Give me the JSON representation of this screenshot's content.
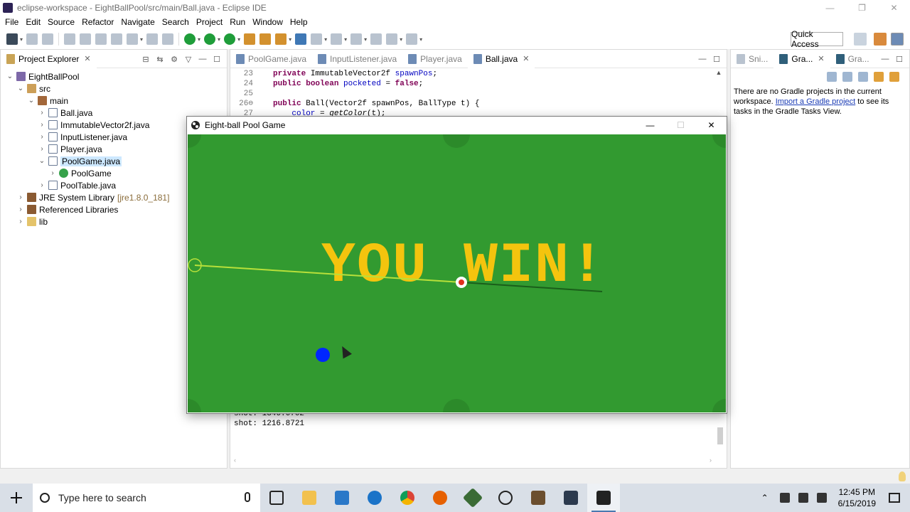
{
  "window": {
    "title": "eclipse-workspace - EightBallPool/src/main/Ball.java - Eclipse IDE",
    "controls": [
      "—",
      "❐",
      "✕"
    ]
  },
  "menu": [
    "File",
    "Edit",
    "Source",
    "Refactor",
    "Navigate",
    "Search",
    "Project",
    "Run",
    "Window",
    "Help"
  ],
  "toolbar": {
    "quick_access": "Quick Access"
  },
  "explorer": {
    "title": "Project Explorer",
    "tree": [
      {
        "label": "EightBallPool",
        "icon": "project-icon",
        "twisty": "⌄",
        "indent": 0
      },
      {
        "label": "src",
        "icon": "source-folder-icon",
        "twisty": "⌄",
        "indent": 1
      },
      {
        "label": "main",
        "icon": "package-icon",
        "twisty": "⌄",
        "indent": 2
      },
      {
        "label": "Ball.java",
        "icon": "java-file-icon",
        "twisty": "›",
        "indent": 3
      },
      {
        "label": "ImmutableVector2f.java",
        "icon": "java-file-icon",
        "twisty": "›",
        "indent": 3
      },
      {
        "label": "InputListener.java",
        "icon": "java-file-icon",
        "twisty": "›",
        "indent": 3
      },
      {
        "label": "Player.java",
        "icon": "java-file-icon",
        "twisty": "›",
        "indent": 3
      },
      {
        "label": "PoolGame.java",
        "icon": "java-file-icon",
        "twisty": "⌄",
        "indent": 3,
        "selected": true
      },
      {
        "label": "PoolGame",
        "icon": "class-icon",
        "twisty": "›",
        "indent": 4
      },
      {
        "label": "PoolTable.java",
        "icon": "java-file-icon",
        "twisty": "›",
        "indent": 3
      },
      {
        "label": "JRE System Library",
        "icon": "library-icon",
        "twisty": "›",
        "indent": 1,
        "suffix": "[jre1.8.0_181]"
      },
      {
        "label": "Referenced Libraries",
        "icon": "library-icon",
        "twisty": "›",
        "indent": 1
      },
      {
        "label": "lib",
        "icon": "folder-icon",
        "twisty": "›",
        "indent": 1
      }
    ]
  },
  "editor": {
    "tabs": [
      {
        "label": "PoolGame.java",
        "active": false
      },
      {
        "label": "InputListener.java",
        "active": false
      },
      {
        "label": "Player.java",
        "active": false
      },
      {
        "label": "Ball.java",
        "active": true
      }
    ],
    "lines": [
      {
        "num": "23",
        "parts": [
          {
            "t": "private ",
            "c": "kw"
          },
          {
            "t": "ImmutableVector2f ",
            "c": ""
          },
          {
            "t": "spawnPos",
            "c": "fld"
          },
          {
            "t": ";",
            "c": ""
          }
        ]
      },
      {
        "num": "24",
        "parts": [
          {
            "t": "public ",
            "c": "kw"
          },
          {
            "t": "boolean ",
            "c": "kw"
          },
          {
            "t": "pocketed",
            "c": "fld"
          },
          {
            "t": " = ",
            "c": ""
          },
          {
            "t": "false",
            "c": "kw"
          },
          {
            "t": ";",
            "c": ""
          }
        ]
      },
      {
        "num": "25",
        "parts": []
      },
      {
        "num": "26⊖",
        "parts": [
          {
            "t": "public ",
            "c": "kw"
          },
          {
            "t": "Ball(Vector2f spawnPos, BallType t) {",
            "c": ""
          }
        ]
      },
      {
        "num": "27",
        "parts": [
          {
            "t": "    color",
            "c": "fld"
          },
          {
            "t": " = ",
            "c": ""
          },
          {
            "t": "getColor",
            "c": "ital"
          },
          {
            "t": "(t);",
            "c": ""
          }
        ]
      }
    ],
    "console": [
      "shot: 1346.6702",
      "shot: 1216.8721"
    ]
  },
  "gradle": {
    "tabs": [
      "Sni...",
      "Gra...",
      "Gra..."
    ],
    "message_before": "There are no Gradle projects in the current workspace. ",
    "link": "Import a Gradle project",
    "message_after": " to see its tasks in the Gradle Tasks View."
  },
  "game": {
    "title": "Eight-ball Pool Game",
    "controls": [
      "—",
      "☐",
      "✕"
    ],
    "message": "YOU WIN!",
    "colors": {
      "table": "#329a30",
      "pocket": "#2c8a2a",
      "text": "#f4c40e",
      "cue_ball": "#ffffff",
      "ball": "#0026ff",
      "aim_line": "#b8e03a"
    }
  },
  "taskbar": {
    "search_placeholder": "Type here to search",
    "apps": [
      "task-view-icon",
      "file-explorer-icon",
      "visual-studio-icon",
      "edge-icon",
      "chrome-icon",
      "firefox-icon",
      "git-icon",
      "unity-icon",
      "minecraft-icon",
      "app-icon",
      "eclipse-icon"
    ],
    "time": "12:45 PM",
    "date": "6/15/2019"
  }
}
